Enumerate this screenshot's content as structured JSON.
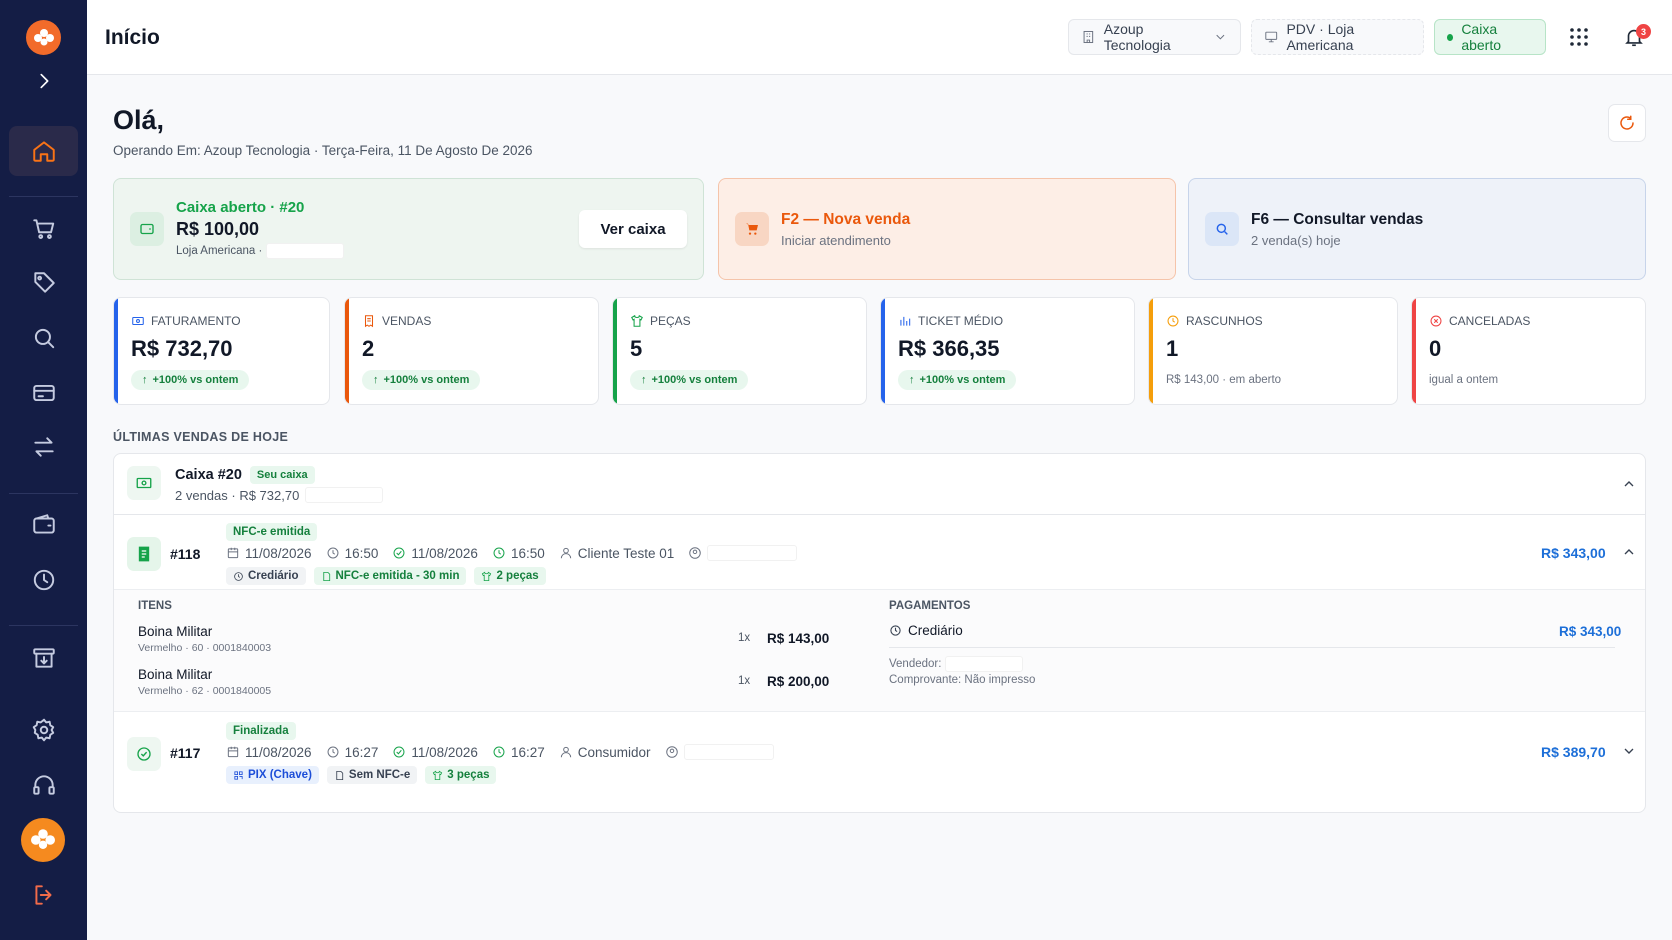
{
  "header": {
    "title": "Início",
    "company": "Azoup Tecnologia",
    "pdv": "PDV · Loja Americana",
    "cash_status": "Caixa aberto",
    "notifications": "3"
  },
  "greeting": {
    "hello": "Olá,",
    "subtitle": "Operando Em: Azoup Tecnologia · Terça-Feira, 11 De Agosto De 2026"
  },
  "cards": {
    "caixa": {
      "title": "Caixa aberto · #20",
      "amount": "R$ 100,00",
      "store": "Loja Americana ·",
      "button": "Ver caixa"
    },
    "nova_venda": {
      "title": "F2 — Nova venda",
      "sub": "Iniciar atendimento"
    },
    "consultar": {
      "title": "F6 — Consultar vendas",
      "sub": "2 venda(s) hoje"
    }
  },
  "kpis": [
    {
      "label": "Faturamento",
      "value": "R$ 732,70",
      "change": "+100% vs ontem",
      "color": "#2563eb",
      "icon": "money-icon"
    },
    {
      "label": "Vendas",
      "value": "2",
      "change": "+100% vs ontem",
      "color": "#ea580c",
      "icon": "receipt-icon"
    },
    {
      "label": "Peças",
      "value": "5",
      "change": "+100% vs ontem",
      "color": "#16a34a",
      "icon": "shirt-icon"
    },
    {
      "label": "Ticket Médio",
      "value": "R$ 366,35",
      "change": "+100% vs ontem",
      "color": "#2563eb",
      "icon": "bar-chart-icon"
    },
    {
      "label": "Rascunhos",
      "value": "1",
      "note": "R$ 143,00 · em aberto",
      "color": "#f59e0b",
      "icon": "clock-icon"
    },
    {
      "label": "Canceladas",
      "value": "0",
      "note": "igual a ontem",
      "color": "#ef4444",
      "icon": "x-circle-icon"
    }
  ],
  "recent": {
    "section_title": "ÚLTIMAS VENDAS DE HOJE",
    "group": {
      "title": "Caixa #20",
      "tag": "Seu caixa",
      "summary": "2 vendas · R$ 732,70"
    },
    "sales": [
      {
        "status": "NFC-e emitida",
        "id": "#118",
        "date1": "11/08/2026",
        "time1": "16:50",
        "date2": "11/08/2026",
        "time2": "16:50",
        "customer": "Cliente Teste 01",
        "tags": [
          "Crediário",
          "NFC-e emitida - 30 min",
          "2 peças"
        ],
        "total": "R$ 343,00"
      },
      {
        "status": "Finalizada",
        "id": "#117",
        "date1": "11/08/2026",
        "time1": "16:27",
        "date2": "11/08/2026",
        "time2": "16:27",
        "customer": "Consumidor",
        "tags": [
          "PIX (Chave)",
          "Sem NFC-e",
          "3 peças"
        ],
        "total": "R$ 389,70"
      }
    ],
    "detail": {
      "items_label": "ITENS",
      "items": [
        {
          "name": "Boina Militar",
          "sub": "Vermelho · 60 · 0001840003",
          "qty": "1x",
          "price": "R$ 143,00"
        },
        {
          "name": "Boina Militar",
          "sub": "Vermelho · 62 · 0001840005",
          "qty": "1x",
          "price": "R$ 200,00"
        }
      ],
      "payments_label": "PAGAMENTOS",
      "payment": {
        "method": "Crediário",
        "amount": "R$ 343,00"
      },
      "seller": "Vendedor:",
      "receipt": "Comprovante: Não impresso"
    }
  }
}
